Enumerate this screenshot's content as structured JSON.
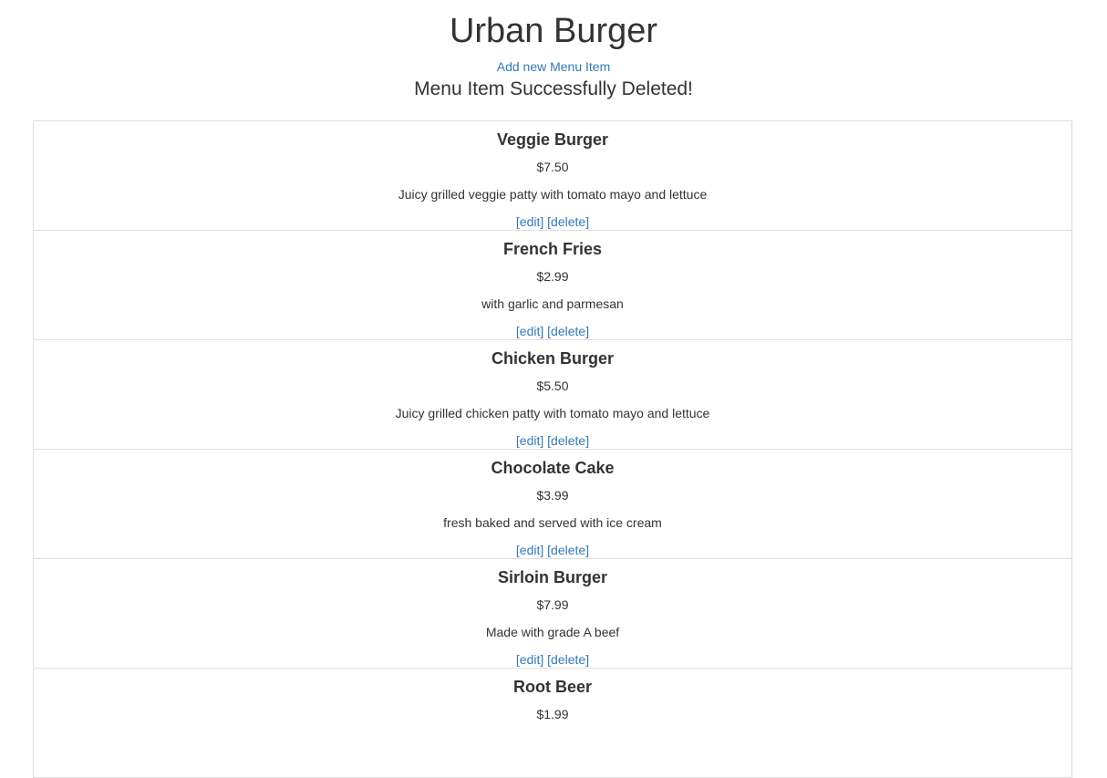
{
  "restaurant": {
    "name": "Urban Burger"
  },
  "links": {
    "add_new": "Add new Menu Item"
  },
  "flash": {
    "message": "Menu Item Successfully Deleted!"
  },
  "actions": {
    "edit": "[edit]",
    "delete": "[delete]"
  },
  "colors": {
    "link": "#337ab7",
    "text": "#333333",
    "border": "#dddddd"
  },
  "menu_items": [
    {
      "name": "Veggie Burger",
      "price": "$7.50",
      "description": "Juicy grilled veggie patty with tomato mayo and lettuce"
    },
    {
      "name": "French Fries",
      "price": "$2.99",
      "description": "with garlic and parmesan"
    },
    {
      "name": "Chicken Burger",
      "price": "$5.50",
      "description": "Juicy grilled chicken patty with tomato mayo and lettuce"
    },
    {
      "name": "Chocolate Cake",
      "price": "$3.99",
      "description": "fresh baked and served with ice cream"
    },
    {
      "name": "Sirloin Burger",
      "price": "$7.99",
      "description": "Made with grade A beef"
    },
    {
      "name": "Root Beer",
      "price": "$1.99",
      "description": ""
    }
  ]
}
